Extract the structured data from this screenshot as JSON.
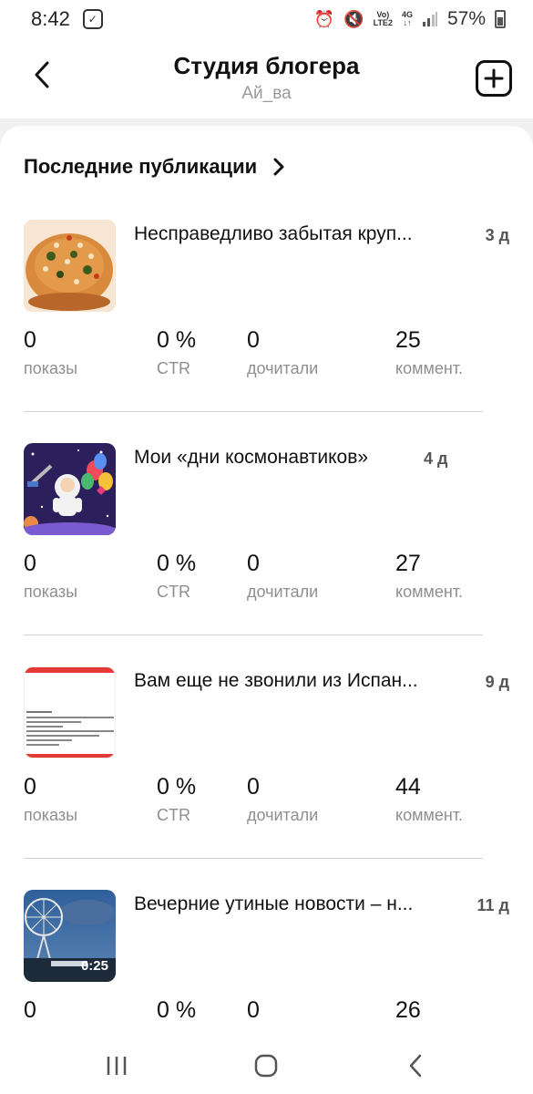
{
  "status": {
    "time": "8:42",
    "volte_top": "Vo)",
    "volte_bottom": "LTE2",
    "network_top": "4G",
    "network_bottom": "↓↑",
    "battery": "57%"
  },
  "header": {
    "title": "Студия блогера",
    "subtitle": "Ай_ва"
  },
  "section": {
    "title": "Последние публикации"
  },
  "publications": [
    {
      "title": "Несправедливо забытая круп...",
      "age": "3 д",
      "stats": [
        {
          "value": "0",
          "label": "показы"
        },
        {
          "value": "0 %",
          "label": "CTR"
        },
        {
          "value": "0",
          "label": "дочитали"
        },
        {
          "value": "25",
          "label": "коммент."
        }
      ]
    },
    {
      "title": "Мои «дни космонавтиков»",
      "age": "4 д",
      "stats": [
        {
          "value": "0",
          "label": "показы"
        },
        {
          "value": "0 %",
          "label": "CTR"
        },
        {
          "value": "0",
          "label": "дочитали"
        },
        {
          "value": "27",
          "label": "коммент."
        }
      ]
    },
    {
      "title": "Вам еще не звонили из Испан...",
      "age": "9 д",
      "stats": [
        {
          "value": "0",
          "label": "показы"
        },
        {
          "value": "0 %",
          "label": "CTR"
        },
        {
          "value": "0",
          "label": "дочитали"
        },
        {
          "value": "44",
          "label": "коммент."
        }
      ]
    },
    {
      "title": "Вечерние утиные новости – н...",
      "age": "11 д",
      "duration": "0:25",
      "stats": [
        {
          "value": "0"
        },
        {
          "value": "0 %"
        },
        {
          "value": "0"
        },
        {
          "value": "26"
        }
      ]
    }
  ]
}
